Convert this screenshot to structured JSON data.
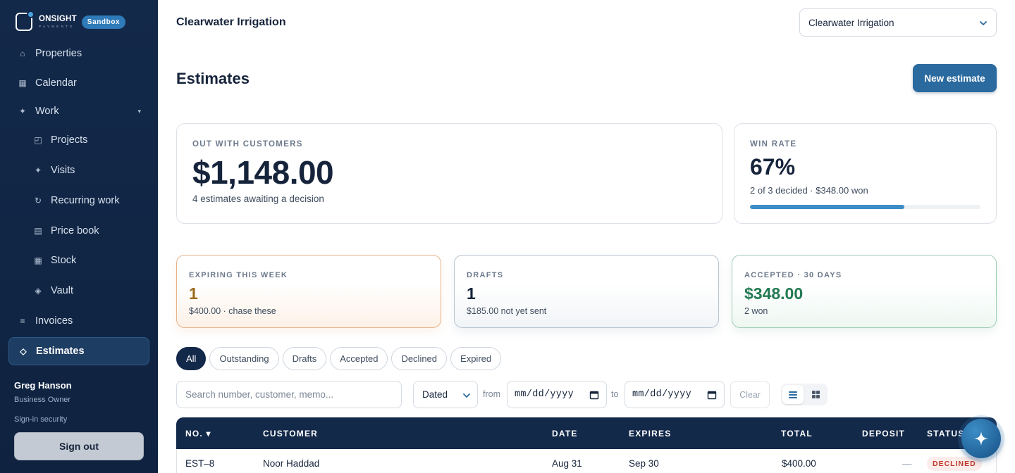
{
  "brand": {
    "name": "ONSIGHT",
    "subtitle": "PAYMENTS",
    "badge": "Sandbox"
  },
  "sidebar": {
    "items": [
      {
        "label": "Properties",
        "icon": "home-icon",
        "glyph": "⌂"
      },
      {
        "label": "Calendar",
        "icon": "calendar-icon",
        "glyph": "▦"
      },
      {
        "label": "Work",
        "icon": "sparkle-icon",
        "glyph": "✦"
      },
      {
        "label": "Projects",
        "icon": "projects-icon",
        "glyph": "◰"
      },
      {
        "label": "Visits",
        "icon": "sparkle-icon",
        "glyph": "✦"
      },
      {
        "label": "Recurring work",
        "icon": "refresh-icon",
        "glyph": "↻"
      },
      {
        "label": "Price book",
        "icon": "book-icon",
        "glyph": "▤"
      },
      {
        "label": "Stock",
        "icon": "grid-icon",
        "glyph": "▦"
      },
      {
        "label": "Vault",
        "icon": "diamond-icon",
        "glyph": "◈"
      },
      {
        "label": "Invoices",
        "icon": "list-icon",
        "glyph": "≡"
      },
      {
        "label": "Estimates",
        "icon": "diamond-outline-icon",
        "glyph": "◇"
      }
    ],
    "work_chevron": "▾",
    "user": {
      "name": "Greg Hanson",
      "role": "Business Owner"
    },
    "signin_security": "Sign-in security",
    "signout_label": "Sign out"
  },
  "header": {
    "company_title": "Clearwater Irrigation",
    "company_select_value": "Clearwater Irrigation"
  },
  "page": {
    "title": "Estimates",
    "new_button": "New estimate"
  },
  "stats": {
    "out_with_customers": {
      "label": "OUT WITH CUSTOMERS",
      "value": "$1,148.00",
      "sub": "4 estimates awaiting a decision"
    },
    "win_rate": {
      "label": "WIN RATE",
      "value": "67%",
      "sub": "2 of 3 decided · $348.00 won",
      "progress": 0.67
    },
    "expiring": {
      "label": "EXPIRING THIS WEEK",
      "value": "1",
      "sub": "$400.00 · chase these"
    },
    "drafts": {
      "label": "DRAFTS",
      "value": "1",
      "sub": "$185.00 not yet sent"
    },
    "accepted": {
      "label": "ACCEPTED · 30 DAYS",
      "value": "$348.00",
      "sub": "2 won"
    }
  },
  "filters": {
    "tabs": [
      "All",
      "Outstanding",
      "Drafts",
      "Accepted",
      "Declined",
      "Expired"
    ],
    "active": "All"
  },
  "toolbar": {
    "search_placeholder": "Search number, customer, memo...",
    "date_type": "Dated",
    "from_label": "from",
    "to_label": "to",
    "date_placeholder": "mm/dd/yyyy",
    "clear_label": "Clear"
  },
  "table": {
    "columns": [
      "NO. ▾",
      "CUSTOMER",
      "DATE",
      "EXPIRES",
      "TOTAL",
      "DEPOSIT",
      "STATUS"
    ],
    "rows": [
      {
        "number": "EST–8",
        "customer": "Noor Haddad",
        "date": "Aug 31",
        "expires": "Sep 30",
        "total": "$400.00",
        "deposit": "—",
        "status": "DECLINED"
      }
    ]
  },
  "colors": {
    "sidebar_bg": "#13294a",
    "accent": "#2a6a9f",
    "declined": "#c0392b",
    "accepted": "#237a52",
    "expiring": "#9a6b1c"
  }
}
